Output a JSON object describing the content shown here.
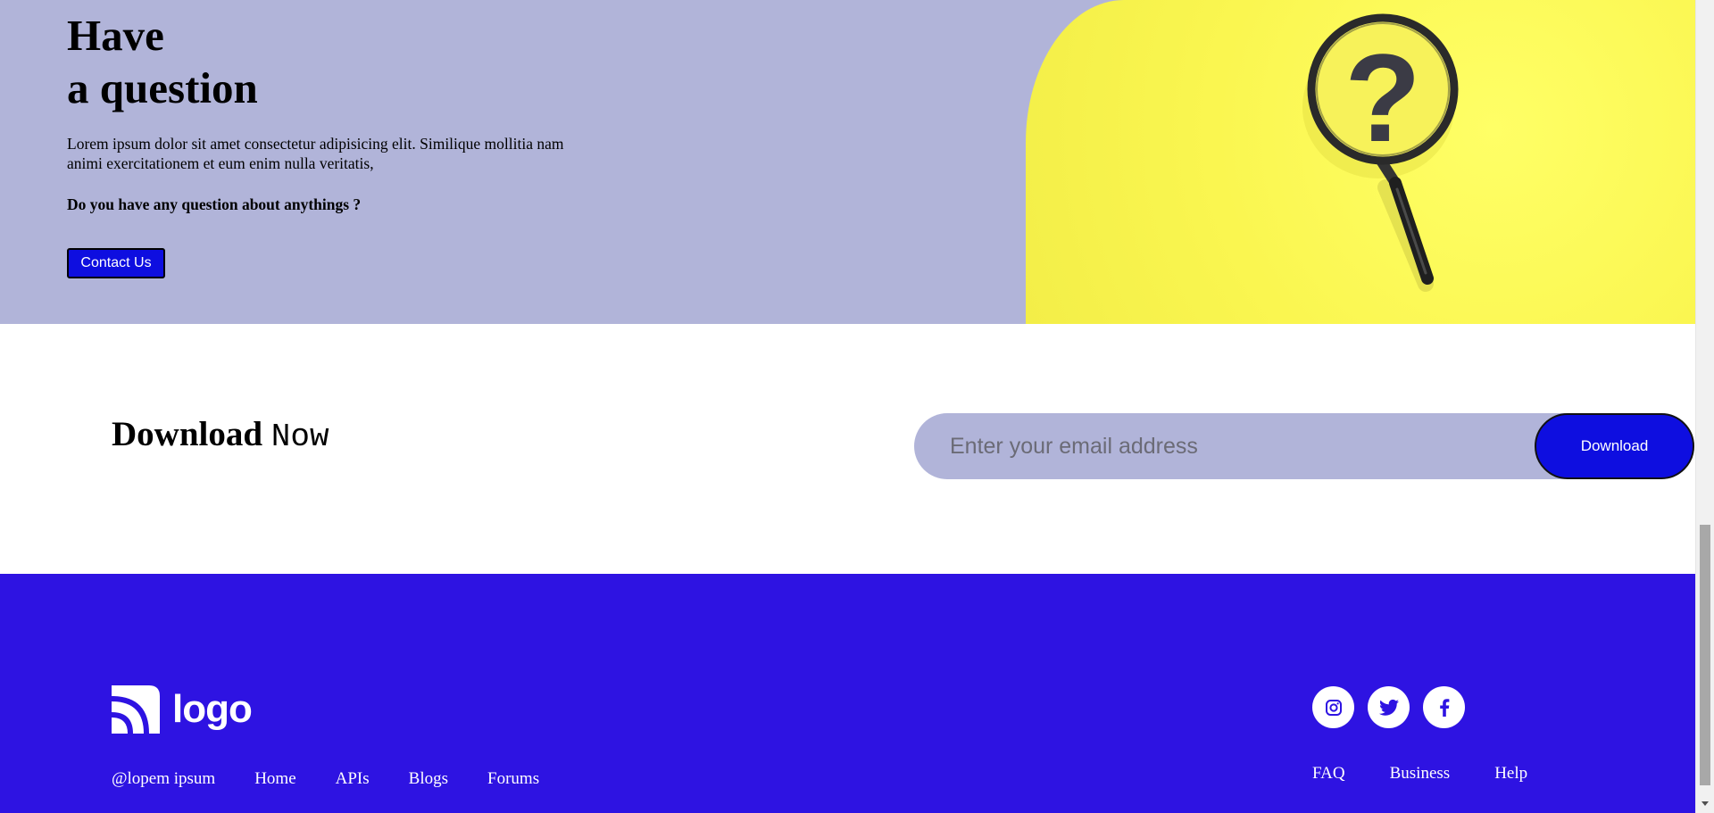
{
  "hero": {
    "title_line1": "Have",
    "title_line2": "a question",
    "text": "Lorem ipsum dolor sit amet consectetur adipisicing elit. Similique mollitia nam animi exercitationem et eum enim nulla veritatis,",
    "question": "Do you have any question about anythings ?",
    "contact_label": "Contact Us",
    "image_icon": "magnifying-glass-question-icon"
  },
  "download": {
    "title_bold": "Download",
    "title_mono": "Now",
    "email_placeholder": "Enter your email address",
    "button_label": "Download"
  },
  "footer": {
    "logo_text": "logo",
    "copyright": "@lopem ipsum",
    "nav_left": [
      "Home",
      "APIs",
      "Blogs",
      "Forums"
    ],
    "nav_right": [
      "FAQ",
      "Business",
      "Help"
    ],
    "social_icons": [
      "instagram-icon",
      "twitter-icon",
      "facebook-icon"
    ]
  },
  "colors": {
    "hero_bg": "#b1b4d9",
    "accent_blue": "#0e0ee0",
    "footer_bg": "#2e13e2",
    "yellow": "#faf650"
  }
}
